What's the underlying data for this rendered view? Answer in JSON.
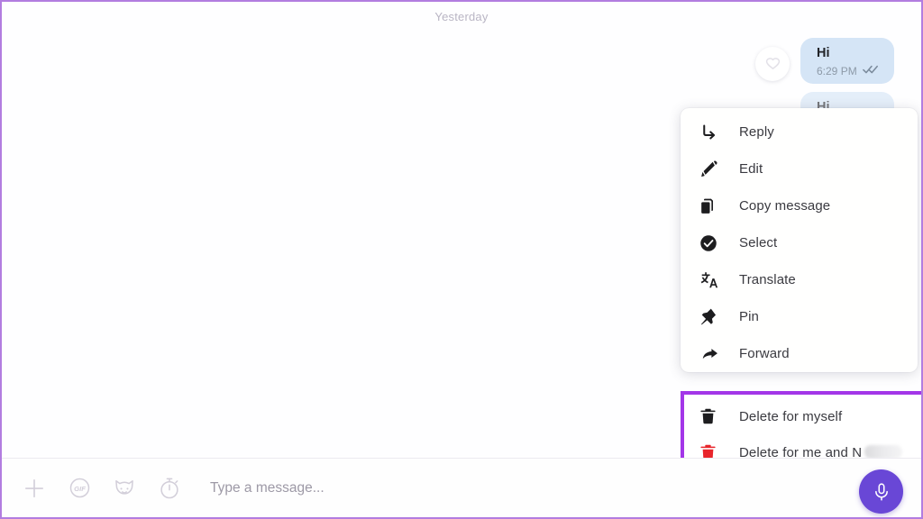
{
  "colors": {
    "highlight_purple": "#a336e8",
    "frame_purple": "#b27de0",
    "bubble_blue": "#d5e5f6",
    "mic_purple": "#6947d6",
    "delete_red": "#e8252b"
  },
  "chat": {
    "date_separator": "Yesterday",
    "reaction_icon": "heart-icon",
    "messages": [
      {
        "text": "Hi",
        "time": "6:29 PM",
        "status_icon": "double-check-icon",
        "outgoing": true
      },
      {
        "text": "Hi",
        "time": "",
        "status_icon": "",
        "outgoing": true
      }
    ]
  },
  "context_menu": {
    "items": [
      {
        "label": "Reply",
        "icon": "reply-arrow-icon"
      },
      {
        "label": "Edit",
        "icon": "pencil-icon"
      },
      {
        "label": "Copy message",
        "icon": "copy-icon"
      },
      {
        "label": "Select",
        "icon": "check-circle-icon"
      },
      {
        "label": "Translate",
        "icon": "translate-icon"
      },
      {
        "label": "Pin",
        "icon": "pin-icon"
      },
      {
        "label": "Forward",
        "icon": "forward-arrow-icon"
      }
    ],
    "delete_group": [
      {
        "label": "Delete for myself",
        "icon": "trash-dark-icon",
        "name_redacted": false
      },
      {
        "label": "Delete for me and N",
        "icon": "trash-red-icon",
        "name_redacted": true
      }
    ]
  },
  "composer": {
    "placeholder": "Type a message...",
    "value": "",
    "icons": [
      "plus-icon",
      "gif-icon",
      "sticker-cat-icon",
      "stopwatch-icon"
    ],
    "mic_icon": "microphone-icon"
  }
}
